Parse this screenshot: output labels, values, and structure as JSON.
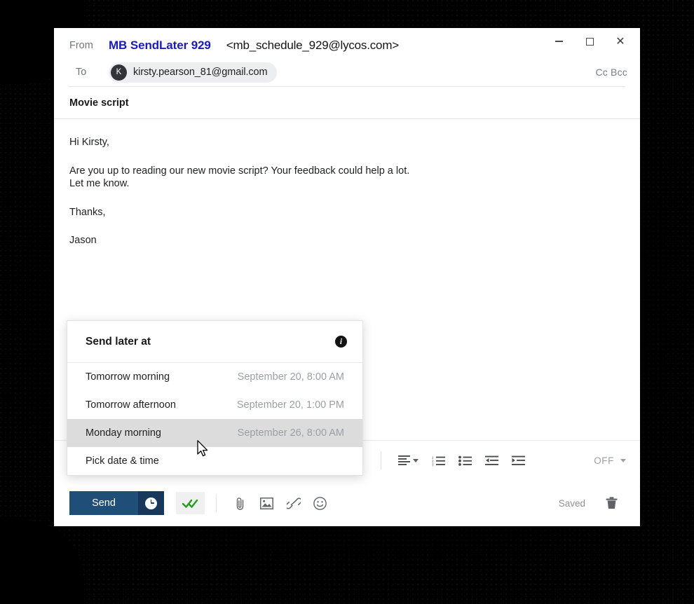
{
  "window": {
    "controls": {
      "minimize_label": "Minimize",
      "maximize_label": "Maximize",
      "close_label": "✕"
    }
  },
  "header": {
    "from_label": "From",
    "from_name": "MB SendLater 929",
    "from_email": "<mb_schedule_929@lycos.com>",
    "to_label": "To",
    "recipient_initial": "K",
    "recipient_email": "kirsty.pearson_81@gmail.com",
    "cc_bcc_label": "Cc Bcc"
  },
  "subject": "Movie script",
  "body": {
    "greeting": "Hi Kirsty,",
    "paragraph_line1": "Are you up to reading our new movie script? Your feedback could help a lot.",
    "paragraph_line2": "Let me know.",
    "closing": "Thanks,",
    "signature": "Jason"
  },
  "format_toolbar": {
    "align_icon": "align-left-icon",
    "numbered_list_icon": "numbered-list-icon",
    "bullet_list_icon": "bullet-list-icon",
    "outdent_icon": "decrease-indent-icon",
    "indent_icon": "increase-indent-icon",
    "off_label": "OFF"
  },
  "action_bar": {
    "send_label": "Send",
    "schedule_icon": "clock-icon",
    "read_receipt_icon": "double-check-icon",
    "attach_icon": "paperclip-icon",
    "image_icon": "image-icon",
    "link_icon": "link-icon",
    "emoji_icon": "emoji-icon",
    "saved_label": "Saved",
    "delete_icon": "trash-icon"
  },
  "send_later_panel": {
    "title": "Send later at",
    "info_icon_glyph": "i",
    "options": [
      {
        "label": "Tomorrow morning",
        "date": "September 20, 8:00 AM",
        "highlighted": false
      },
      {
        "label": "Tomorrow afternoon",
        "date": "September 20, 1:00 PM",
        "highlighted": false
      },
      {
        "label": "Monday morning",
        "date": "September 26, 8:00 AM",
        "highlighted": true
      },
      {
        "label": "Pick date & time",
        "date": "",
        "highlighted": false
      }
    ]
  },
  "colors": {
    "from_name": "#1a19c8",
    "send_button": "#1f4e79",
    "send_schedule_button": "#17385a",
    "highlight_row": "#dcdcdc",
    "check_green": "#20a020",
    "muted_text": "#9b9fa4",
    "backdrop": "#000000"
  }
}
